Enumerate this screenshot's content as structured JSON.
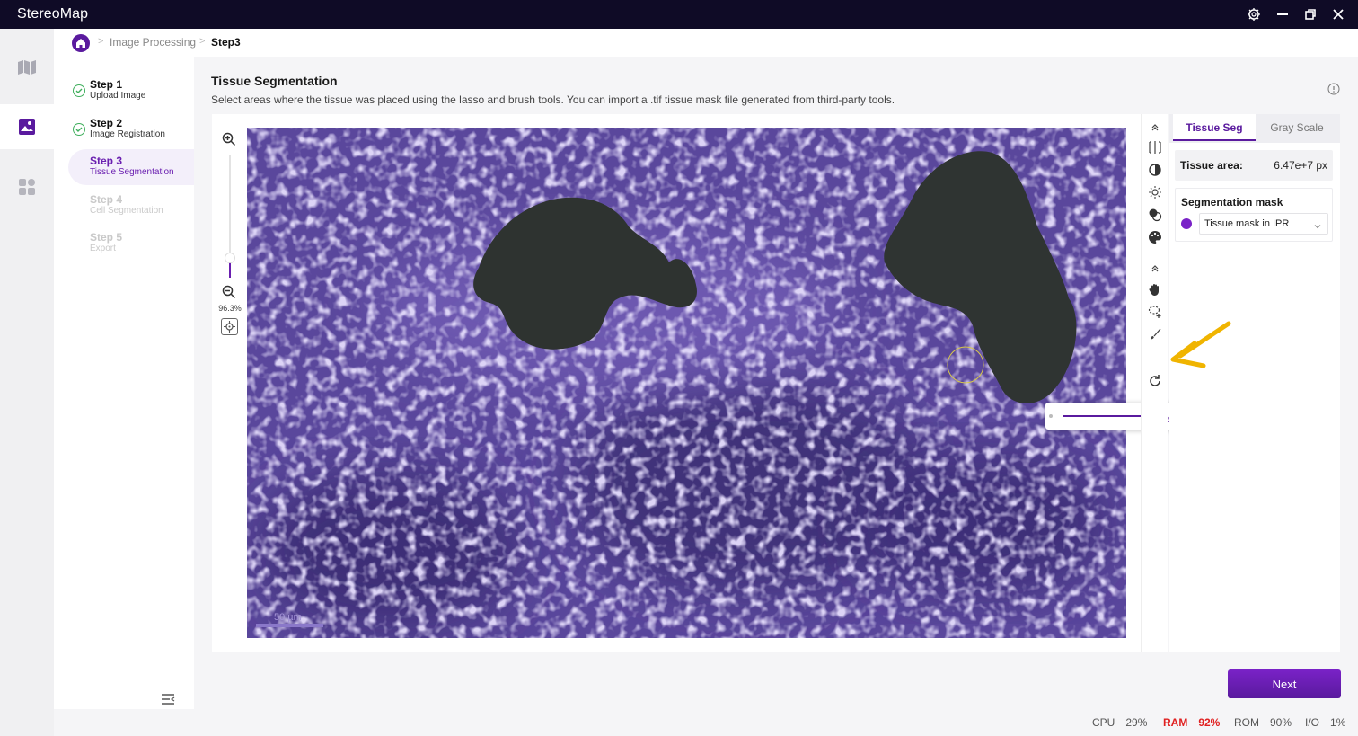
{
  "app": {
    "title": "StereoMap"
  },
  "breadcrumb": {
    "parent": "Image Processing",
    "current": "Step3"
  },
  "steps": [
    {
      "title": "Step 1",
      "subtitle": "Upload Image",
      "status": "done"
    },
    {
      "title": "Step 2",
      "subtitle": "Image Registration",
      "status": "done"
    },
    {
      "title": "Step 3",
      "subtitle": "Tissue Segmentation",
      "status": "active"
    },
    {
      "title": "Step 4",
      "subtitle": "Cell Segmentation",
      "status": "pending"
    },
    {
      "title": "Step 5",
      "subtitle": "Export",
      "status": "pending"
    }
  ],
  "main": {
    "title": "Tissue Segmentation",
    "description": "Select areas where the tissue was placed using the lasso and brush tools. You can import a .tif tissue mask file generated from third-party tools."
  },
  "viewer": {
    "zoom_pct": "96.3%",
    "scale_bar": "50 µm",
    "zoom_slider_level": 0.1,
    "brush_size_level": 0.9
  },
  "right_panel": {
    "tabs": [
      "Tissue Seg",
      "Gray Scale"
    ],
    "tissue_area_label": "Tissue area:",
    "tissue_area_value": "6.47e+7 px",
    "mask_title": "Segmentation mask",
    "mask_selected": "Tissue mask in IPR"
  },
  "actions": {
    "next": "Next"
  },
  "status": {
    "cpu_label": "CPU",
    "cpu": "29%",
    "ram_label": "RAM",
    "ram": "92%",
    "rom_label": "ROM",
    "rom": "90%",
    "io_label": "I/O",
    "io": "1%"
  },
  "colors": {
    "accent": "#5a1a9e",
    "overlay": "#6a4cb8",
    "warning": "#e02020",
    "annotation": "#f0b400"
  }
}
